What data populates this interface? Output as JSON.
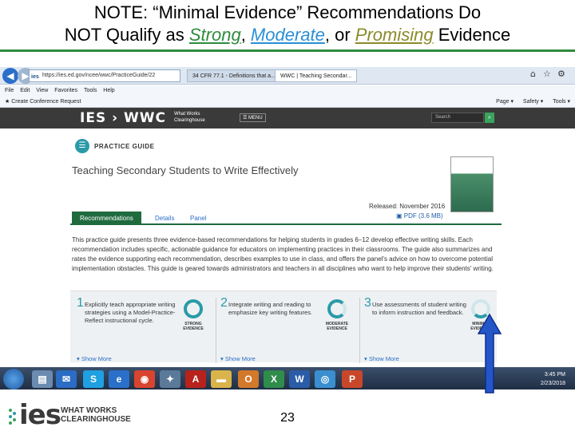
{
  "slide": {
    "title_line1": "NOTE: “Minimal Evidence” Recommendations Do",
    "title_line2_a": "NOT Qualify as ",
    "strong": "Strong",
    "comma": ", ",
    "moderate": "Moderate",
    "or": ", or ",
    "promising": "Promising",
    "title_line2_b": " Evidence",
    "page_number": "23",
    "colors": {
      "strong": "#2e8b3d",
      "moderate": "#2a8fd6",
      "promising": "#8a8a2a",
      "rule": "#2e8b3d"
    }
  },
  "browser": {
    "address": "https://ies.ed.gov/ncee/wwc/PracticeGuide/22",
    "tabs": [
      "34 CFR 77.1 - Definitions that a...",
      "WWC | Teaching Secondar..."
    ],
    "menu": [
      "File",
      "Edit",
      "View",
      "Favorites",
      "Tools",
      "Help"
    ],
    "favorites_item": "Create Conference Request",
    "tools": [
      "Page ▾",
      "Safety ▾",
      "Tools ▾"
    ]
  },
  "wwc": {
    "logo": "IES › WWC",
    "sub": "What Works Clearinghouse",
    "menu_label": "☰ MENU",
    "search_placeholder": "Search",
    "practice_guide_label": "PRACTICE GUIDE",
    "page_title": "Teaching Secondary Students to Write Effectively",
    "released": "Released: November 2016",
    "pdf": "PDF (3.6 MB)",
    "tabs": [
      "Recommendations",
      "Details",
      "Panel"
    ],
    "intro": "This practice guide presents three evidence-based recommendations for helping students in grades 6–12 develop effective writing skills. Each recommendation includes specific, actionable guidance for educators on implementing practices in their classrooms. The guide also summarizes and rates the evidence supporting each recommendation, describes examples to use in class, and offers the panel's advice on how to overcome potential implementation obstacles. This guide is geared towards administrators and teachers in all disciplines who want to help improve their students' writing.",
    "recommendations": [
      {
        "num": "1",
        "text": "Explicitly teach appropriate writing strategies using a Model-Practice-Reflect instructional cycle.",
        "badge": "STRONG EVIDENCE",
        "more": "▾ Show More"
      },
      {
        "num": "2",
        "text": "Integrate writing and reading to emphasize key writing features.",
        "badge": "MODERATE EVIDENCE",
        "more": "▾ Show More"
      },
      {
        "num": "3",
        "text": "Use assessments of student writing to inform instruction and feedback.",
        "badge": "MINIMAL EVIDENCE",
        "more": "▾ Show More"
      }
    ]
  },
  "taskbar": {
    "time": "3:45 PM",
    "date": "2/23/2018"
  },
  "footer": {
    "ies": "ies",
    "line1": "WHAT WORKS",
    "line2": "CLEARINGHOUSE"
  }
}
